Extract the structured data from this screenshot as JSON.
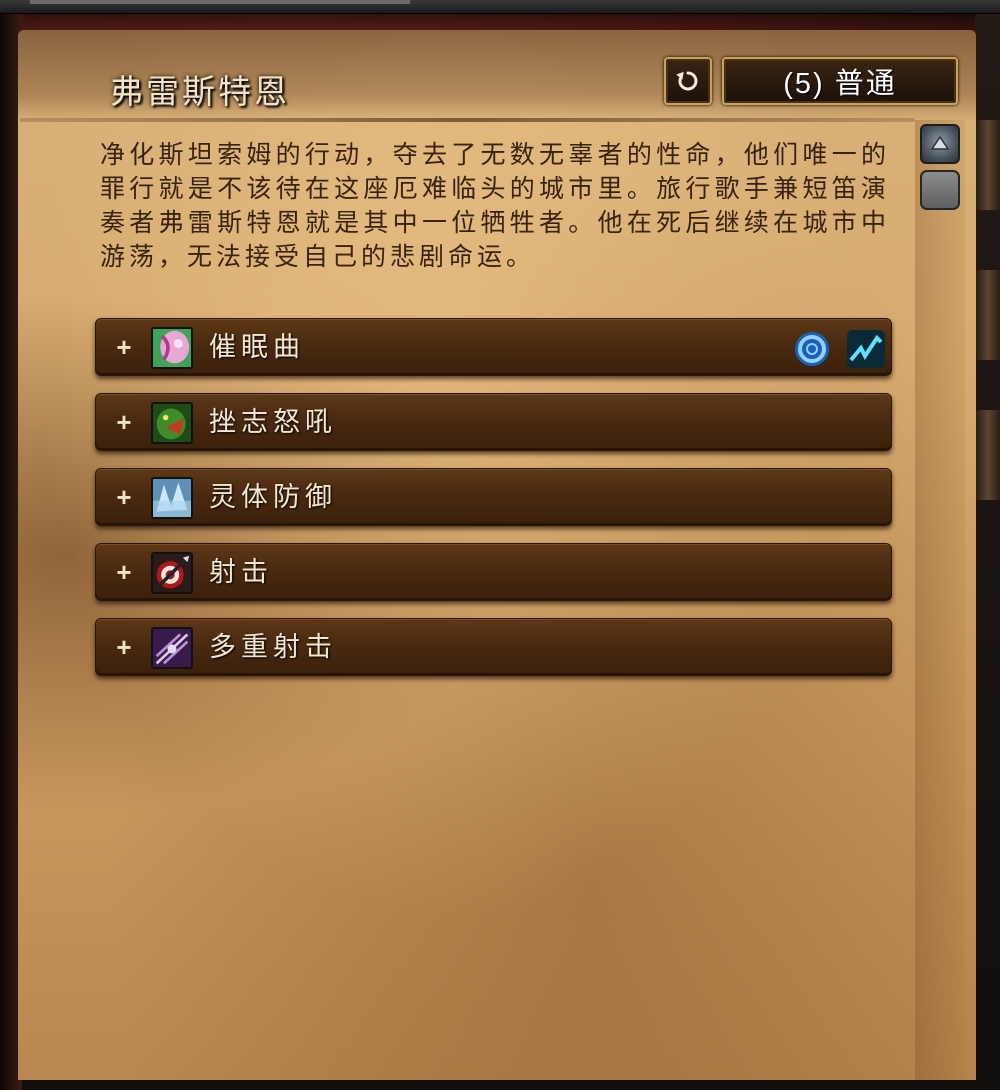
{
  "encounter": {
    "title": "弗雷斯特恩",
    "difficulty_label": "(5) 普通",
    "description": "净化斯坦索姆的行动，夺去了无数无辜者的性命，他们唯一的罪行就是不该待在这座厄难临头的城市里。旅行歌手兼短笛演奏者弗雷斯特恩就是其中一位牺牲者。他在死后继续在城市中游荡，无法接受自己的悲剧命运。"
  },
  "abilities": [
    {
      "expand": "+",
      "name": "催眠曲",
      "icon": "lullaby-icon",
      "flags": [
        "magic-dispel-icon",
        "interrupt-icon"
      ]
    },
    {
      "expand": "+",
      "name": "挫志怒吼",
      "icon": "demoralizing-shout-icon",
      "flags": []
    },
    {
      "expand": "+",
      "name": "灵体防御",
      "icon": "spirit-defense-icon",
      "flags": []
    },
    {
      "expand": "+",
      "name": "射击",
      "icon": "shoot-icon",
      "flags": []
    },
    {
      "expand": "+",
      "name": "多重射击",
      "icon": "multishot-icon",
      "flags": []
    }
  ],
  "colors": {
    "title_text": "#f2e2c8",
    "description_text": "#3a2310",
    "row_background": "#4a2a10",
    "button_border": "#c7a35a"
  }
}
